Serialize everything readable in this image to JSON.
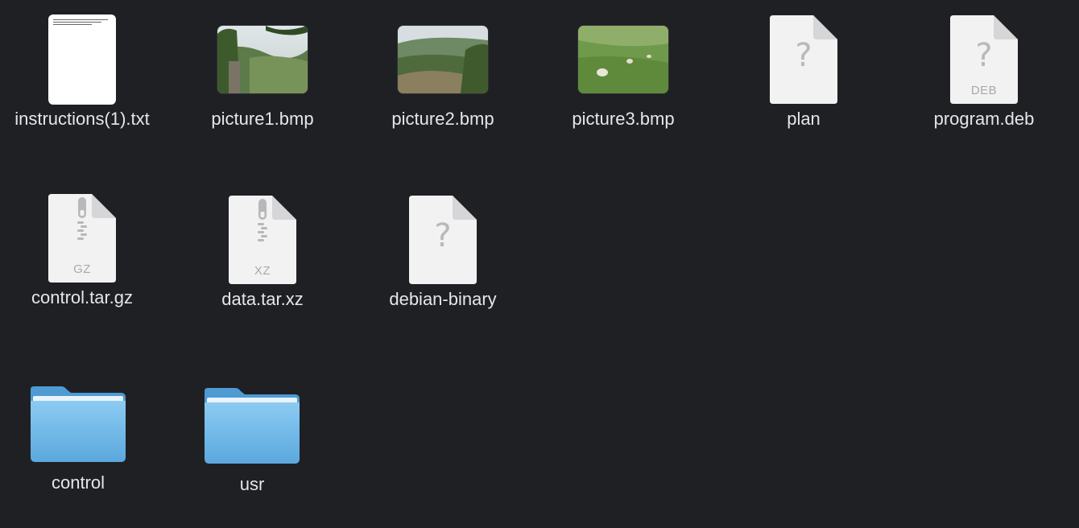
{
  "window": {
    "background": "#1f2024"
  },
  "items": [
    {
      "id": "instructions",
      "name": "instructions(1).txt",
      "kind": "text-file-thumbnail"
    },
    {
      "id": "picture1",
      "name": "picture1.bmp",
      "kind": "image-thumbnail"
    },
    {
      "id": "picture2",
      "name": "picture2.bmp",
      "kind": "image-thumbnail"
    },
    {
      "id": "picture3",
      "name": "picture3.bmp",
      "kind": "image-thumbnail"
    },
    {
      "id": "plan",
      "name": "plan",
      "kind": "generic-document",
      "glyph": "?"
    },
    {
      "id": "program-deb",
      "name": "program.deb",
      "kind": "generic-document",
      "glyph": "?",
      "badge": "DEB"
    },
    {
      "id": "control-tar-gz",
      "name": "control.tar.gz",
      "kind": "archive-document",
      "badge": "GZ"
    },
    {
      "id": "data-tar-xz",
      "name": "data.tar.xz",
      "kind": "archive-document",
      "badge": "XZ"
    },
    {
      "id": "debian-binary",
      "name": "debian-binary",
      "kind": "generic-document",
      "glyph": "?"
    },
    {
      "id": "control-folder",
      "name": "control",
      "kind": "folder"
    },
    {
      "id": "usr-folder",
      "name": "usr",
      "kind": "folder"
    }
  ],
  "colors": {
    "label": "#e6e6e7",
    "document": "#f2f2f3",
    "document_fold": "#d6d6d8",
    "folder_top": "#8ccbf2",
    "folder_bottom": "#5aa8de"
  }
}
